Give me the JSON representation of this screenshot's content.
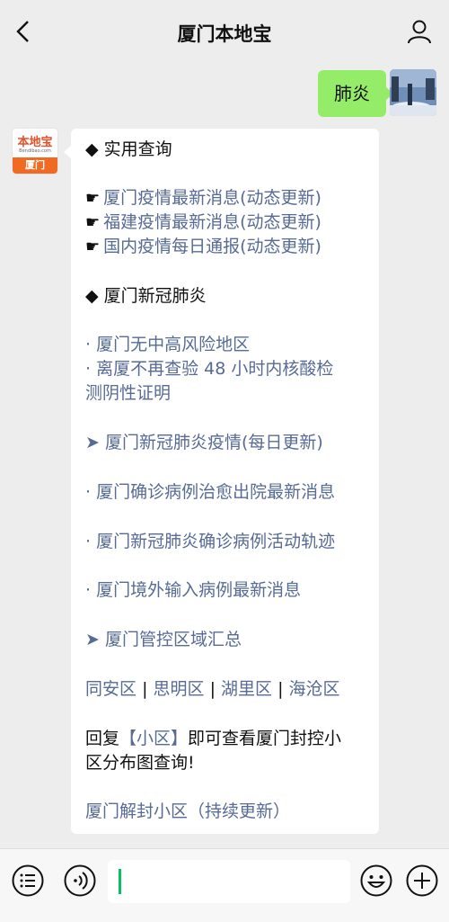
{
  "header": {
    "title": "厦门本地宝",
    "back_icon": "chevron-left-icon",
    "profile_icon": "person-icon"
  },
  "user_message": {
    "text": "肺炎"
  },
  "bot": {
    "avatar": {
      "logo": "本地宝",
      "logo_sub": "Bendibao.com",
      "city": "厦门"
    },
    "lines": {
      "l1": "◆ 实用查询",
      "l2": "厦门疫情最新消息(动态更新)",
      "l3": "福建疫情最新消息(动态更新)",
      "l4": "国内疫情每日通报(动态更新)",
      "l5": "◆ 厦门新冠肺炎",
      "l6": "· 厦门无中高风险地区",
      "l7a": "· 离厦不再查验 48 小时内核酸检",
      "l7b": "测阴性证明",
      "l8": "➤ 厦门新冠肺炎疫情(每日更新)",
      "l9": "· 厦门确诊病例治愈出院最新消息",
      "l10": "· 厦门新冠肺炎确诊病例活动轨迹",
      "l11": "· 厦门境外输入病例最新消息",
      "l12": "➤ 厦门管控区域汇总",
      "d1": "同安区",
      "d2": "思明区",
      "d3": "湖里区",
      "d4": "海沧区",
      "sep": "|",
      "r1a": "回复",
      "r1b": "【小区】",
      "r1c": "即可查看厦门封控小",
      "r2": "区分布图查询!",
      "l13": "厦门解封小区（持续更新）"
    },
    "hand_glyph": "☛"
  },
  "bottom_bar": {
    "voice_icon": "voice-icon",
    "emoji_icon": "emoji-icon",
    "plus_icon": "plus-icon",
    "menu_icon": "menu-icon"
  },
  "colors": {
    "link": "#576b95",
    "user_bubble": "#95ec69",
    "cursor": "#07c160"
  }
}
